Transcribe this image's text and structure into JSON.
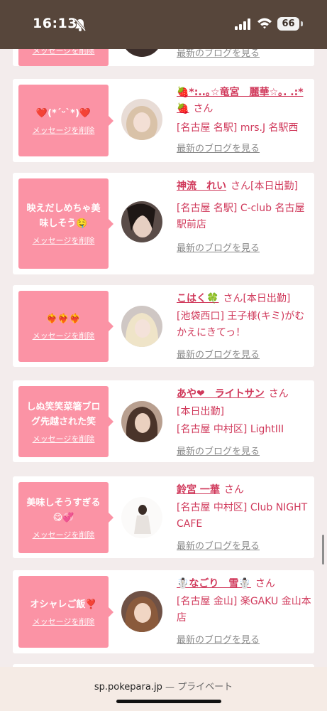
{
  "status": {
    "time": "16:13",
    "battery": "66"
  },
  "delete_label": "メッセージを削除",
  "blog_label": "最新のブログを見る",
  "honorific": "さん",
  "cards": [
    {
      "message": "",
      "name": "",
      "detail": ""
    },
    {
      "message": "❤️(*´ᵕ`*)❤️",
      "name": "🍓*:..｡☆竜宮　麗華☆｡. .:*🍓",
      "tag": "",
      "detail": "[名古屋 名駅] mrs.J 名駅西"
    },
    {
      "message": "映えだしめちゃ美味しそう🤤",
      "name": "神流　れい",
      "tag": "[本日出勤]",
      "detail": "[名古屋 名駅] C-club 名古屋駅前店"
    },
    {
      "message": "❤️‍🔥❤️‍🔥❤️‍🔥",
      "name": "こはく🍀",
      "tag": "[本日出勤]",
      "detail": "[池袋西口] 王子様(キミ)がむかえにきてっ！"
    },
    {
      "message": "しぬ笑笑菜箸ブログ先越された笑",
      "name": "あや❤︎　ライトサン",
      "tag": "",
      "line2": "[本日出勤]",
      "detail": "[名古屋 中村区] LightIII"
    },
    {
      "message": "美味しそうすぎる😋💞",
      "name": "鈴宮 一華",
      "tag": "",
      "detail": "[名古屋 中村区] Club NIGHT CAFE"
    },
    {
      "message": "オシャレご飯❣️",
      "name": "☃️なごり　雪☃️",
      "tag": "",
      "detail": "[名古屋 金山] 楽GAKU 金山本店"
    }
  ],
  "url_bar": {
    "domain": "sp.pokepara.jp",
    "separator": " — ",
    "mode": "プライベート"
  }
}
